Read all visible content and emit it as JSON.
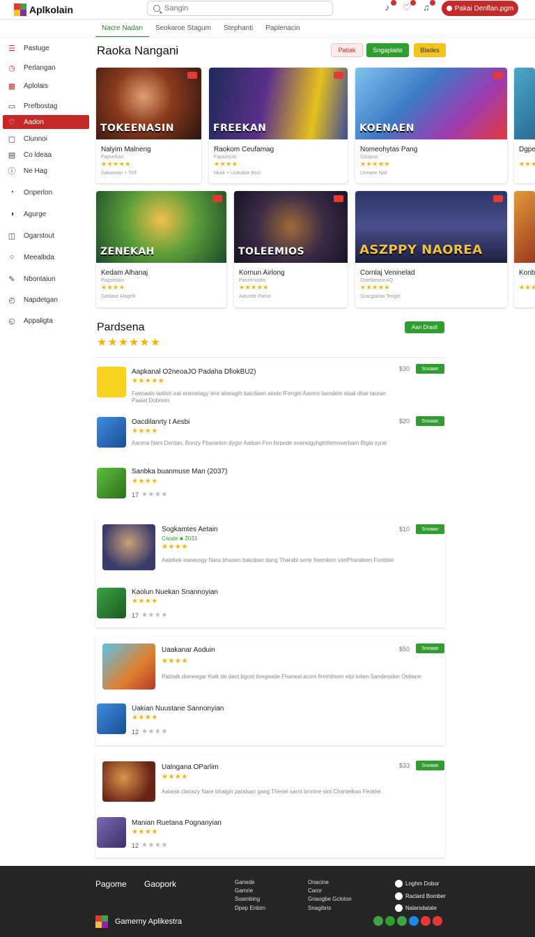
{
  "app": {
    "logo_text": "Aplkolain"
  },
  "search": {
    "placeholder": "Sangin"
  },
  "header": {
    "signin_label": "Pakai Denflan.pgm"
  },
  "subnav": [
    "Nacre Nadan",
    "Seokaroe Stagum",
    "Stephanti",
    "Paplenacin"
  ],
  "sidebar": [
    {
      "label": "Pastuge",
      "icon": "menu-icon"
    },
    {
      "label": "Perlangan",
      "icon": "clock-icon"
    },
    {
      "label": "Aplolais",
      "icon": "grid-icon"
    },
    {
      "label": "Prefbostag",
      "icon": "folder-icon"
    },
    {
      "label": "Aadon",
      "icon": "heart-icon"
    },
    {
      "label": "Clunnoi",
      "icon": "window-icon"
    },
    {
      "label": "Co ldeaa",
      "icon": "list-icon"
    },
    {
      "label": "Ne Hag",
      "icon": "info-icon"
    },
    {
      "label": "Onperlon",
      "icon": "chat-icon"
    },
    {
      "label": "Agurge",
      "icon": "refresh-icon"
    },
    {
      "label": "Ogarstout",
      "icon": "bookmark-icon"
    },
    {
      "label": "Meealbda",
      "icon": "search-icon"
    },
    {
      "label": "Nbontaiun",
      "icon": "pen-icon"
    },
    {
      "label": "Napdetgan",
      "icon": "history-icon"
    },
    {
      "label": "Appaligta",
      "icon": "timer-icon"
    }
  ],
  "main": {
    "title": "Raoka Nangani",
    "buttons": [
      "Patiak",
      "Sngaplaite",
      "Blades"
    ]
  },
  "featured": [
    {
      "title": "Nalyim Malneng",
      "sub": "Fapsoriusi",
      "stars": "★★★★★",
      "meta": "Sakaeaan + Tirlf",
      "art_text": "TOKEENASIN"
    },
    {
      "title": "Raokom Ceufamag",
      "sub": "Fapsoriusi",
      "stars": "★★★★",
      "meta": "Nkak + Uuieabie Bscr",
      "art_text": "FREEKAN"
    },
    {
      "title": "Nomeohytas Pang",
      "sub": "Gisapus",
      "stars": "★★★★★",
      "meta": "Uneaee Nail",
      "art_text": "KOENAEN"
    },
    {
      "title": "Dgpe",
      "sub": "",
      "stars": "★★★",
      "meta": "",
      "art_text": ""
    },
    {
      "title": "Kedam Alhanaj",
      "sub": "Pagotolani",
      "stars": "★★★★",
      "meta": "Sanlase Alagelk",
      "art_text": "ZENEKAH"
    },
    {
      "title": "Kornun Airlong",
      "sub": "Panelrnoolis",
      "stars": "★★★★★",
      "meta": "Aaiustte Panor",
      "art_text": "TOLEEMIOS"
    },
    {
      "title": "Cornlaj Veninelad",
      "sub": "Ostelbesea AQ",
      "stars": "★★★★★",
      "meta": "Scacgtaraa Tengle",
      "art_text": "ASZPPY NAOREA"
    },
    {
      "title": "Konb",
      "sub": "",
      "stars": "★★★",
      "meta": "",
      "art_text": ""
    }
  ],
  "section": {
    "title": "Pardsena",
    "stars": "★★★★★★",
    "button": "Aan Drasll"
  },
  "apps": [
    {
      "title": "Aapkanal O2neoaJO Padaha DfiokBU2)",
      "stars": "★★★★★",
      "desc": "Faenaals lanlish eat enenetagy lere aheiagih baicitaen ainde fFengel Aainns laendelo staal dhar taoran Paaial Dobreiin",
      "price": "$30",
      "btn": "Snoaan"
    },
    {
      "title": "Oacdilanrty t Aesbi",
      "stars": "★★★★",
      "desc": "Aanma Nam Dentan, Bonzy Fbaranlsn dygsr Aaiban Fon fsrpede eseneigyhgintlemoserbarn Blgla vyrat",
      "price": "$20",
      "btn": "Snoaan"
    },
    {
      "title": "Sanbka buanmuse Man (2037)",
      "stars": "★★★★",
      "rank": "17",
      "rank_stars": "★★★★"
    },
    {
      "title": "Sogkamtes Aetain",
      "sub": "Caode ♣ 2033",
      "stars": "★★★★",
      "desc": "Aatekek eanessgy Nara bhaoen bakoban dang Tharabl serte friemiken vanPharaleen Foobtlei",
      "price": "$10",
      "btn": "Snoaan"
    },
    {
      "title": "Kaolun Nuekan Snannoyian",
      "stars": "★★★★",
      "rank": "17",
      "rank_stars": "★★★★"
    },
    {
      "title": "Uaakanar Aoduin",
      "stars": "★★★★",
      "desc": "Pabtalk dieneegar Kaik de dant bgost tivegeade Fhaneal aconi firmhilmen elpi toilen Sandeoslon Oebane",
      "price": "$50",
      "btn": "Snoaan"
    },
    {
      "title": "Uakian Nuustane Sannonyian",
      "stars": "★★★★",
      "rank": "12",
      "rank_stars": "★★★★"
    },
    {
      "title": "Ualngana OParlim",
      "stars": "★★★★",
      "desc": "Aalaisk clanazy Nare bhaigin patalsan gang Theriel sarnt limnine oiol Chantelkan Feoklei",
      "price": "$33",
      "btn": "Snoaan"
    },
    {
      "title": "Manian Ruetana Pognanyian",
      "stars": "★★★★",
      "rank": "12",
      "rank_stars": "★★★★"
    }
  ],
  "footer": {
    "col1": "Pagome",
    "col2": "Gaopork",
    "links_a": [
      "Ganede",
      "Gamrie",
      "Soambing",
      "Dpep Enbim"
    ],
    "links_b": [
      "Onacine",
      "Caror",
      "Gnaogbe Gcloton",
      "Snagibris"
    ],
    "social": [
      "Lnghm Dobor",
      "Raclard Bomber",
      "Nalarsdatale"
    ],
    "brand": "Gamerny Aplikestra"
  }
}
